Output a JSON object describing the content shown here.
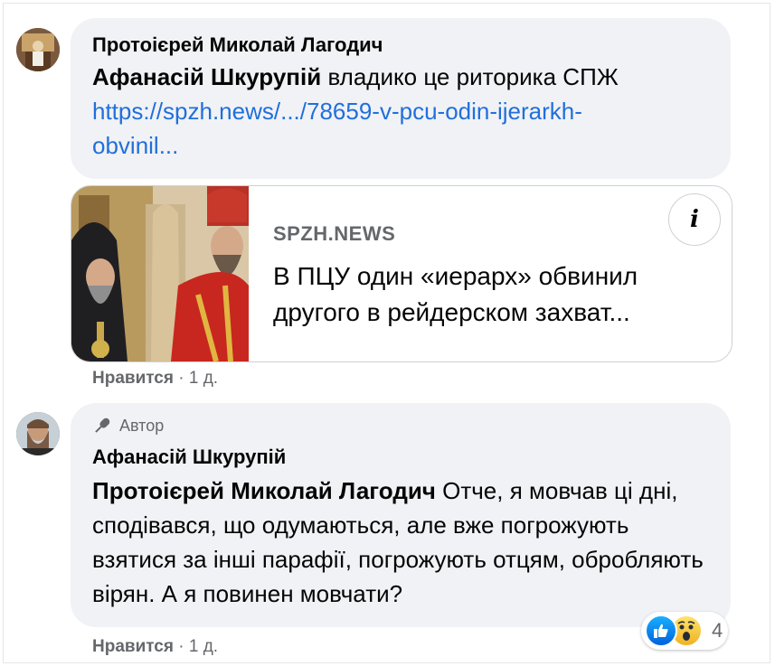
{
  "comment1": {
    "author": "Протоієрей Миколай Лагодич",
    "mention": "Афанасій Шкурупій",
    "text": " владико це риторика СПЖ",
    "link_line1": "https://spzh.news/.../78659-v-pcu-odin-ijerarkh-",
    "link_line2": "obvinil...",
    "preview": {
      "domain": "SPZH.NEWS",
      "title": "В ПЦУ один «иерарх» обвинил другого в рейдерском захват...",
      "info_glyph": "i"
    },
    "like_label": "Нравится",
    "separator": " · ",
    "time": "1 д."
  },
  "comment2": {
    "badge_icon": "microphone-icon",
    "badge": "Автор",
    "author": "Афанасій Шкурупій",
    "mention": "Протоієрей Миколай Лагодич",
    "text": " Отче, я мовчав ці дні, сподівався, що одумаються, але вже погрожують взятися за інші парафії, погрожують отцям, обробляють вірян. А я повинен мовчати?",
    "reactions": {
      "icons": [
        "like-icon",
        "wow-icon"
      ],
      "count": "4"
    },
    "like_label": "Нравится",
    "separator": " · ",
    "time": "1 д."
  },
  "colors": {
    "bubble": "#f0f2f5",
    "link": "#216fdb",
    "meta": "#65676b",
    "like_blue": "#1877f2"
  }
}
